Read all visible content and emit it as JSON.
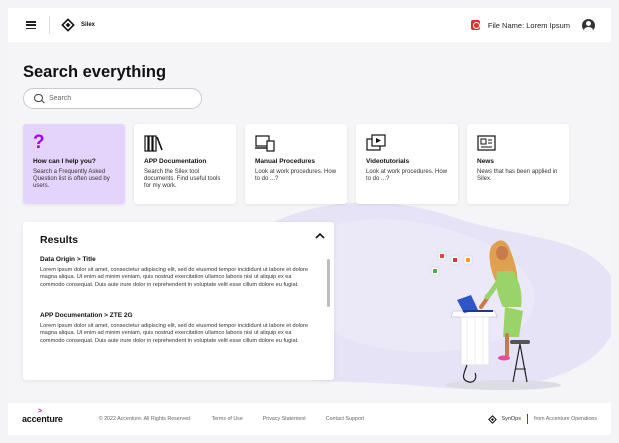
{
  "header": {
    "brand": "Silex",
    "file_label": "File Name: Lorem Ipsum"
  },
  "main": {
    "title": "Search everything",
    "search": {
      "placeholder": "Search",
      "value": ""
    },
    "cards": [
      {
        "icon": "question-icon",
        "title": "How can I help you?",
        "desc": "Search a Frequently Asked Question list is often used by users."
      },
      {
        "icon": "books-icon",
        "title": "APP Documentation",
        "desc": "Search the Silex tool documents. Find useful tools for my work."
      },
      {
        "icon": "laptop-document-icon",
        "title": "Manual Procedures",
        "desc": "Look at work procedures. How to do ...?"
      },
      {
        "icon": "video-tutorial-icon",
        "title": "Videotutorials",
        "desc": "Look at work procedures. How to do ...?"
      },
      {
        "icon": "newspaper-icon",
        "title": "News",
        "desc": "News that has been applied in Silex."
      }
    ],
    "results": {
      "title": "Results",
      "items": [
        {
          "title": "Data Origin > Title",
          "text": "Lorem ipsum dolor sit amet, consectetur adipiscing elit, sed do eiusmod tempor incididunt ut labore et dolore magna aliqua. Ut enim ad minim veniam, quis nostrud exercitation ullamco laboris nisi ut aliquip ex ea commodo consequat. Duis aute irure dolor in reprehenderit in voluptate velit esse cillum dolore eu fugiat."
        },
        {
          "title": "APP Documentation > ZTE 2G",
          "text": "Lorem ipsum dolor sit amet, consectetur adipiscing elit, sed do eiusmod tempor incididunt ut labore et dolore magna aliqua. Ut enim ad minim veniam, quis nostrud exercitation ullamco laboris nisi ut aliquip ex ea commodo consequat. Duis aute irure dolor in reprehenderit in voluptate velit esse cillum dolore eu fugiat."
        }
      ]
    }
  },
  "footer": {
    "brand": "accenture",
    "copyright": "© 2022 Accenture. All Rights Reserved.",
    "links": [
      "Terms of Use",
      "Privacy Statement",
      "Contact Support"
    ],
    "synops": "SynOps",
    "synops_sub": "from Accenture Operations"
  },
  "colors": {
    "accent": "#a100ff",
    "help_card_bg": "#e4d4fb",
    "file_icon": "#e03030"
  }
}
